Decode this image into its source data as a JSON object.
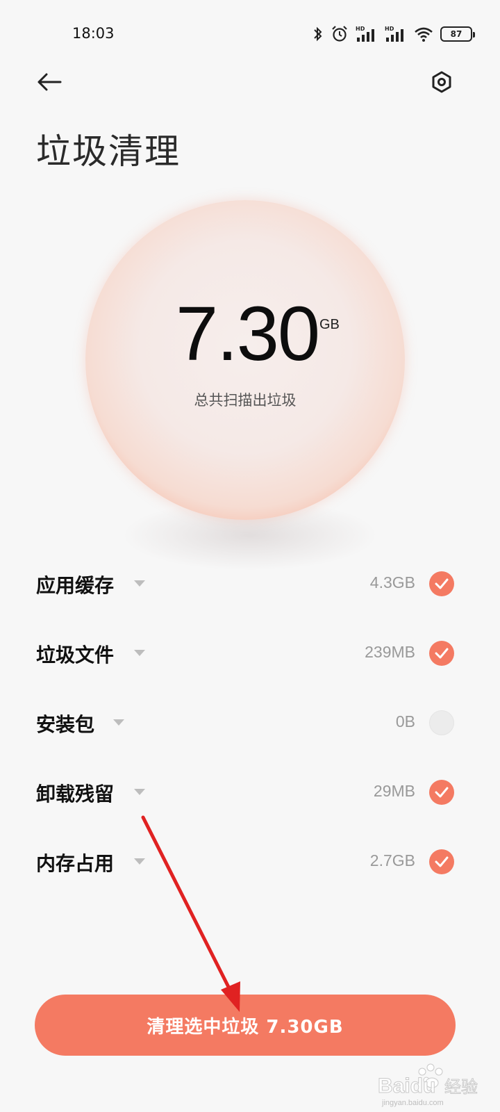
{
  "status_bar": {
    "time": "18:03",
    "battery_level": "87",
    "icons": [
      "bluetooth-icon",
      "alarm-icon",
      "hd-signal-icon",
      "hd-signal-icon",
      "wifi-icon",
      "battery-icon"
    ]
  },
  "header": {
    "back_icon": "arrow-left-icon",
    "settings_icon": "settings-hexagon-icon",
    "title": "垃圾清理"
  },
  "summary": {
    "value": "7.30",
    "unit": "GB",
    "caption": "总共扫描出垃圾"
  },
  "categories": [
    {
      "label": "应用缓存",
      "size": "4.3GB",
      "checked": true
    },
    {
      "label": "垃圾文件",
      "size": "239MB",
      "checked": true
    },
    {
      "label": "安装包",
      "size": "0B",
      "checked": false
    },
    {
      "label": "卸载残留",
      "size": "29MB",
      "checked": true
    },
    {
      "label": "内存占用",
      "size": "2.7GB",
      "checked": true
    }
  ],
  "action": {
    "clean_label": "清理选中垃圾 7.30GB"
  },
  "colors": {
    "accent": "#f47a62",
    "background": "#f7f7f7",
    "arrow": "#e02222"
  },
  "watermark": {
    "logo_text": "Baidu 经验",
    "url": "jingyan.baidu.com"
  }
}
